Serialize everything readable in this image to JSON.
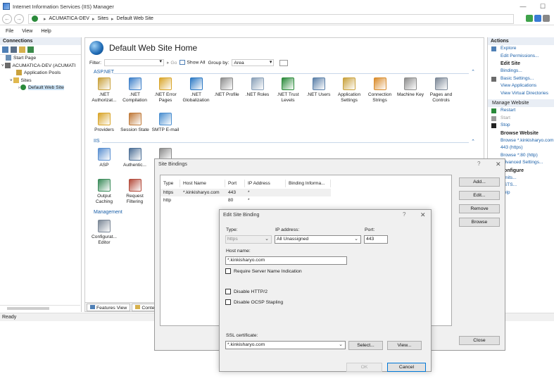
{
  "window": {
    "title": "Internet Information Services (IIS) Manager",
    "min_glyph": "—",
    "max_glyph": "☐"
  },
  "address": {
    "crumbs": [
      "ACUMATICA-DEV",
      "Sites",
      "Default Web Site"
    ],
    "separator": "▸",
    "arrow": "▸"
  },
  "menu": [
    "File",
    "View",
    "Help"
  ],
  "connections": {
    "header": "Connections",
    "tree": [
      {
        "label": "Start Page",
        "icon": "start-page-icon",
        "color": "#6a8fb5"
      },
      {
        "label": "ACUMATICA-DEV (ACUMATI",
        "icon": "server-icon",
        "color": "#6b6b6b"
      },
      {
        "label": "Application Pools",
        "icon": "app-pool-icon",
        "color": "#c9a13c"
      },
      {
        "label": "Sites",
        "icon": "folder-icon",
        "color": "#e0b84f"
      },
      {
        "label": "Default Web Site",
        "icon": "globe-icon",
        "color": "#2a8a3a"
      }
    ]
  },
  "center": {
    "title": "Default Web Site Home",
    "filter_label": "Filter:",
    "go_label": "Go",
    "show_all_label": "Show All",
    "group_by_label": "Group by:",
    "group_by_value": "Area",
    "sections": {
      "aspnet": "ASP.NET",
      "iis": "IIS",
      "management": "Management"
    },
    "aspnet_features": [
      {
        "line1": ".NET",
        "line2": "Authorizat...",
        "color": "#c9a13c"
      },
      {
        "line1": ".NET",
        "line2": "Compilation",
        "color": "#3c7fc9"
      },
      {
        "line1": ".NET Error",
        "line2": "Pages",
        "color": "#d9a52a"
      },
      {
        "line1": ".NET",
        "line2": "Globalization",
        "color": "#2c79c4"
      },
      {
        "line1": ".NET Profile",
        "line2": "",
        "color": "#8e8e8e"
      },
      {
        "line1": ".NET Roles",
        "line2": "",
        "color": "#8aa0b8"
      },
      {
        "line1": ".NET Trust",
        "line2": "Levels",
        "color": "#2a8a3a"
      },
      {
        "line1": ".NET Users",
        "line2": "",
        "color": "#5a7fa8"
      },
      {
        "line1": "Application",
        "line2": "Settings",
        "color": "#c9a13c"
      },
      {
        "line1": "Connection",
        "line2": "Strings",
        "color": "#d98b2a"
      },
      {
        "line1": "Machine Key",
        "line2": "",
        "color": "#8c8c8c"
      },
      {
        "line1": "Pages and",
        "line2": "Controls",
        "color": "#7b8796"
      },
      {
        "line1": "Providers",
        "line2": "",
        "color": "#d9a52a"
      },
      {
        "line1": "Session State",
        "line2": "",
        "color": "#c07a3a"
      },
      {
        "line1": "SMTP E-mail",
        "line2": "",
        "color": "#4b8fd0"
      }
    ],
    "iis_features": [
      {
        "line1": "ASP",
        "line2": "",
        "color": "#5a8fd0"
      },
      {
        "line1": "Authentic...",
        "line2": "",
        "color": "#4d6f96"
      },
      {
        "line1": "C",
        "line2": "",
        "color": "#8a8a8a"
      },
      {
        "line1": "Output",
        "line2": "Caching",
        "color": "#3b8b5a"
      },
      {
        "line1": "Request",
        "line2": "Filtering",
        "color": "#b34a3a"
      },
      {
        "line1": "S",
        "line2": "",
        "color": "#8a8a8a"
      }
    ],
    "mgmt_features": [
      {
        "line1": "Configurat...",
        "line2": "Editor",
        "color": "#7b8796"
      }
    ],
    "tabs": {
      "features": "Features View",
      "content": "Content V"
    }
  },
  "actions": {
    "header": "Actions",
    "items": [
      {
        "label": "Explore",
        "kind": "link",
        "icon": "explore-icon"
      },
      {
        "label": "Edit Permissions...",
        "kind": "link",
        "icon": ""
      },
      {
        "label": "Edit Site",
        "kind": "heading",
        "icon": ""
      },
      {
        "label": "Bindings...",
        "kind": "link",
        "icon": ""
      },
      {
        "label": "Basic Settings...",
        "kind": "link",
        "icon": "settings-icon"
      },
      {
        "label": "View Applications",
        "kind": "link",
        "icon": ""
      },
      {
        "label": "View Virtual Directories",
        "kind": "link",
        "icon": ""
      },
      {
        "label": "Manage Website",
        "kind": "group",
        "icon": ""
      },
      {
        "label": "Restart",
        "kind": "link",
        "icon": "restart-icon"
      },
      {
        "label": "Start",
        "kind": "disabled",
        "icon": "start-icon"
      },
      {
        "label": "Stop",
        "kind": "link",
        "icon": "stop-icon"
      },
      {
        "label": "Browse Website",
        "kind": "heading",
        "icon": ""
      },
      {
        "label": "Browse *.kinkisharyo.com",
        "kind": "link",
        "icon": ""
      },
      {
        "label": "443 (https)",
        "kind": "link",
        "icon": ""
      },
      {
        "label": "Browse *:80 (http)",
        "kind": "link",
        "icon": ""
      },
      {
        "label": "Advanced Settings...",
        "kind": "link",
        "icon": ""
      },
      {
        "label": "Configure",
        "kind": "heading",
        "icon": ""
      },
      {
        "label": "Limits...",
        "kind": "link",
        "icon": ""
      },
      {
        "label": "HSTS...",
        "kind": "link",
        "icon": ""
      },
      {
        "label": "Help",
        "kind": "link",
        "icon": ""
      }
    ]
  },
  "status": "Ready",
  "site_bindings": {
    "title": "Site Bindings",
    "help": "?",
    "close_glyph": "✕",
    "columns": [
      "Type",
      "Host Name",
      "Port",
      "IP Address",
      "Binding Informa..."
    ],
    "rows": [
      {
        "type": "https",
        "host": "*.kinkisharyo.com",
        "port": "443",
        "ip": "*",
        "info": ""
      },
      {
        "type": "http",
        "host": "",
        "port": "80",
        "ip": "*",
        "info": ""
      }
    ],
    "buttons": {
      "add": "Add...",
      "edit": "Edit...",
      "remove": "Remove",
      "browse": "Browse",
      "close": "Close"
    }
  },
  "edit_binding": {
    "title": "Edit Site Binding",
    "help": "?",
    "close_glyph": "✕",
    "type_label": "Type:",
    "type_value": "https",
    "ip_label": "IP address:",
    "ip_value": "All Unassigned",
    "port_label": "Port:",
    "port_value": "443",
    "host_label": "Host name:",
    "host_value": "*.kinkisharyo.com",
    "sni_label": "Require Server Name Indication",
    "http2_label": "Disable HTTP/2",
    "ocsp_label": "Disable OCSP Stapling",
    "ssl_label": "SSL certificate:",
    "ssl_value": "*.kinkisharyo.com",
    "select_label": "Select...",
    "view_label": "View...",
    "ok_label": "OK",
    "cancel_label": "Cancel"
  }
}
